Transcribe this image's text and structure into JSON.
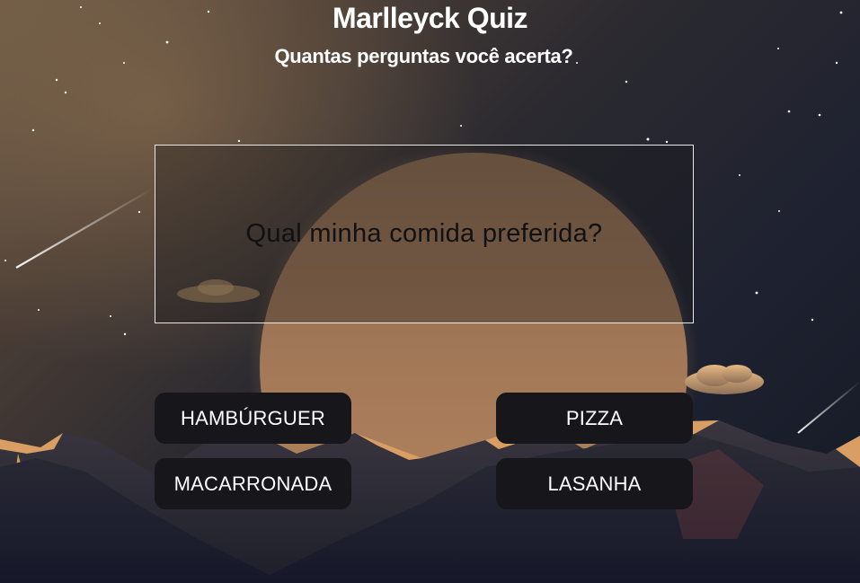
{
  "header": {
    "title": "Marlleyck Quiz",
    "subtitle": "Quantas perguntas você acerta?"
  },
  "question": {
    "text": "Qual minha comida preferida?"
  },
  "answers": [
    {
      "label": "HAMBÚRGUER"
    },
    {
      "label": "PIZZA"
    },
    {
      "label": "MACARRONADA"
    },
    {
      "label": "LASANHA"
    }
  ],
  "colors": {
    "sky_dark": "#151a26",
    "sky_warm": "#6b5845",
    "planet": "#a87d5c",
    "mountain": "#2a2a33",
    "ridge_highlight": "#e3a86a",
    "button_bg": "#16161b"
  }
}
